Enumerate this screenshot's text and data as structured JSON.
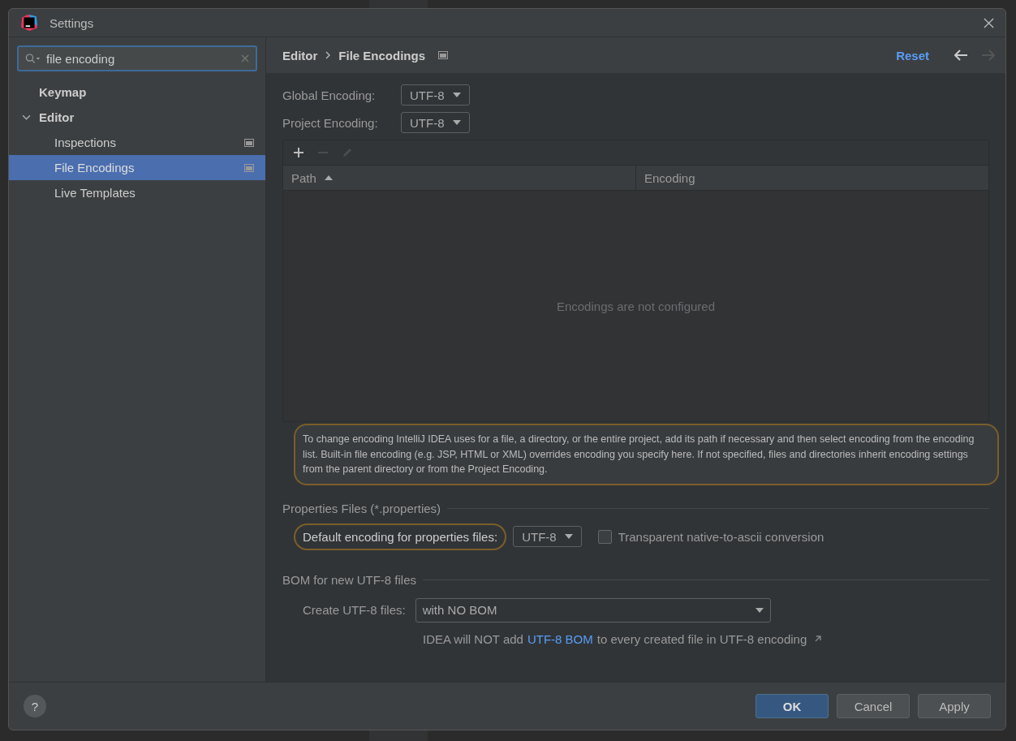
{
  "window": {
    "title": "Settings"
  },
  "search": {
    "value": "file encoding"
  },
  "sidebar": {
    "items": [
      {
        "label": "Keymap",
        "selected": false,
        "project_scoped": false
      },
      {
        "label": "Editor",
        "selected": false,
        "project_scoped": false,
        "expanded": true,
        "children": [
          {
            "label": "Inspections",
            "selected": false,
            "project_scoped": true
          },
          {
            "label": "File Encodings",
            "selected": true,
            "project_scoped": true
          },
          {
            "label": "Live Templates",
            "selected": false,
            "project_scoped": false
          }
        ]
      }
    ]
  },
  "breadcrumb": {
    "items": [
      "Editor",
      "File Encodings"
    ],
    "project_scoped": true,
    "reset": "Reset",
    "back_enabled": true,
    "forward_enabled": false
  },
  "encodings": [
    {
      "label": "Global Encoding:",
      "value": "UTF-8"
    },
    {
      "label": "Project Encoding:",
      "value": "UTF-8"
    }
  ],
  "table": {
    "toolbar": [
      {
        "kind": "add",
        "disabled": false
      },
      {
        "kind": "remove",
        "disabled": true
      },
      {
        "kind": "edit",
        "disabled": true
      }
    ],
    "columns": [
      {
        "label": "Path",
        "sorted": true
      },
      {
        "label": "Encoding",
        "sorted": false
      }
    ],
    "empty_text": "Encodings are not configured"
  },
  "help_text": "To change encoding IntelliJ IDEA uses for a file, a directory, or the entire project, add its path if necessary and then select encoding from the encoding list. Built-in file encoding (e.g. JSP, HTML or XML) overrides encoding you specify here. If not specified, files and directories inherit encoding settings from the parent directory or from the Project Encoding.",
  "properties": {
    "title": "Properties Files (*.properties)",
    "label": "Default encoding for properties files:",
    "value": "UTF-8",
    "checkbox": {
      "label": "Transparent native-to-ascii conversion",
      "checked": false
    }
  },
  "bom": {
    "title": "BOM for new UTF-8 files",
    "label": "Create UTF-8 files:",
    "value": "with NO BOM",
    "note_before": "IDEA will NOT add",
    "note_link": "UTF-8 BOM",
    "note_after": "to every created file in UTF-8 encoding"
  },
  "footer": {
    "help": "?",
    "buttons": [
      {
        "label": "OK",
        "primary": true
      },
      {
        "label": "Cancel",
        "primary": false
      },
      {
        "label": "Apply",
        "primary": false
      }
    ]
  }
}
